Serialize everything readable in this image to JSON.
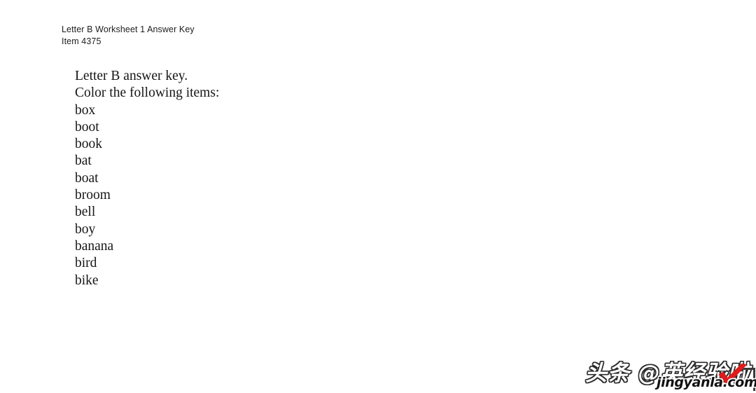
{
  "document": {
    "header": {
      "line1": "Letter B Worksheet 1 Answer Key",
      "line2": "Item 4375"
    },
    "body": {
      "title": "Letter B answer key.",
      "instruction": "Color the following items:",
      "words": [
        "box",
        "boot",
        "book",
        "bat",
        "boat",
        "broom",
        "bell",
        "boy",
        "banana",
        "bird",
        "bike"
      ]
    }
  },
  "watermark": {
    "main_text": "头条 @英经验啦",
    "logo_text": "jingyanla.com",
    "check_color": "#e01b1b",
    "outline_color": "#2b2b2b"
  },
  "colors": {
    "page_background": "#ffffff",
    "header_text": "#1d1d1d",
    "body_text": "#161616"
  }
}
